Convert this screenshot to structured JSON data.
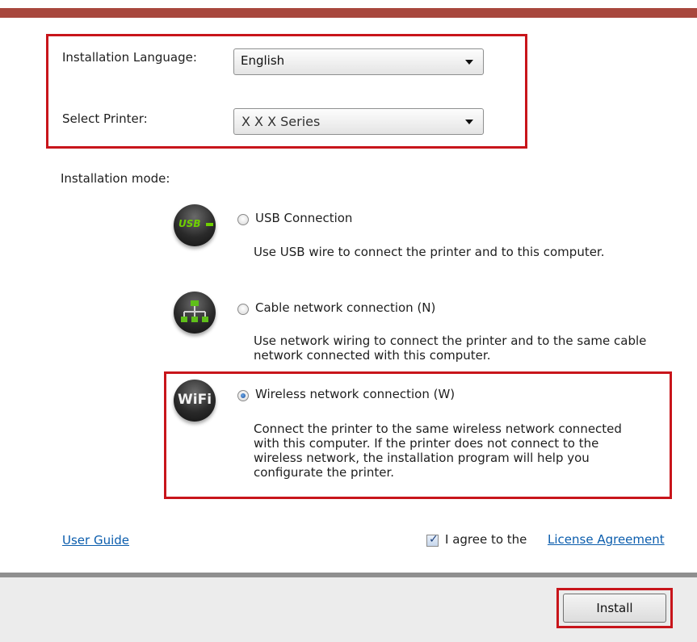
{
  "settings": {
    "language_label": "Installation Language:",
    "language_value": "English",
    "printer_label": "Select Printer:",
    "printer_value": "X X X  Series"
  },
  "mode": {
    "heading": "Installation mode:",
    "options": [
      {
        "icon": "usb-icon",
        "icon_text": "USB",
        "label": "USB Connection",
        "description": "Use USB wire to connect the printer and to this computer.",
        "selected": false
      },
      {
        "icon": "network-icon",
        "label": "Cable network connection (N)",
        "description_lines": [
          "Use network wiring to connect the printer and to the same cable",
          "network connected with this computer."
        ],
        "selected": false
      },
      {
        "icon": "wifi-icon",
        "icon_text": "WiFi",
        "label": "Wireless network connection (W)",
        "description_lines": [
          "Connect the printer to the same wireless network connected",
          "with this computer. If the printer does not connect to the",
          "wireless network, the installation program will help you",
          "configurate the printer."
        ],
        "selected": true
      }
    ]
  },
  "links": {
    "user_guide": "User Guide",
    "agree_text": "I agree to the",
    "license": "License Agreement"
  },
  "agree_checked": true,
  "footer": {
    "install_label": "Install"
  },
  "colors": {
    "highlight": "#c8151b",
    "title_strip": "#a8473d",
    "link": "#0b5dad"
  }
}
